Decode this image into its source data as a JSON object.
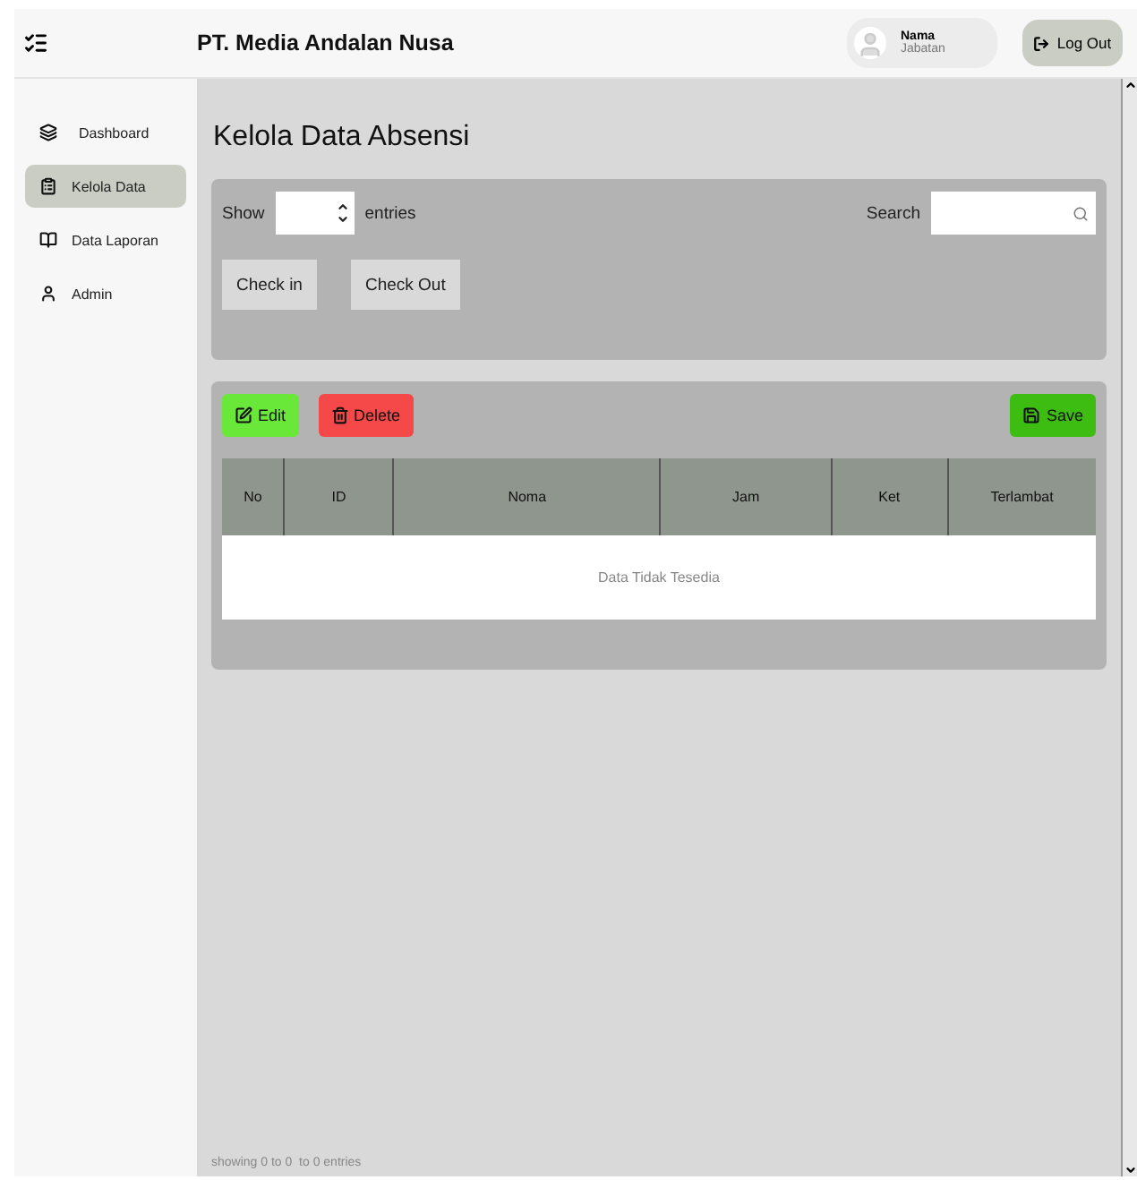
{
  "header": {
    "company": "PT. Media Andalan Nusa",
    "user": {
      "name": "Nama",
      "role": "Jabatan"
    },
    "logout": "Log Out"
  },
  "sidebar": {
    "items": [
      {
        "label": "Dashboard",
        "kind": "layers",
        "selected": false
      },
      {
        "label": "Kelola Data",
        "kind": "clipboard",
        "selected": true
      },
      {
        "label": "Data Laporan",
        "kind": "book",
        "selected": false
      },
      {
        "label": "Admin",
        "kind": "user",
        "selected": false
      }
    ]
  },
  "page_title": "Kelola Data Absensi",
  "filters": {
    "show_label": "Show",
    "entries_label": "entries",
    "search_label": "Search"
  },
  "actions": [
    "Check in",
    "Check Out"
  ],
  "toolbar": [
    {
      "label": "Edit",
      "kind": "edit"
    },
    {
      "label": "Delete",
      "kind": "delete"
    },
    {
      "label": "Save",
      "kind": "save"
    }
  ],
  "table": {
    "columns": [
      "No",
      "ID",
      "Noma",
      "Jam",
      "Ket",
      "Terlambat"
    ],
    "empty_message": "Data Tidak Tesedia"
  },
  "footer": "showing 0 to 0  to 0 entries"
}
